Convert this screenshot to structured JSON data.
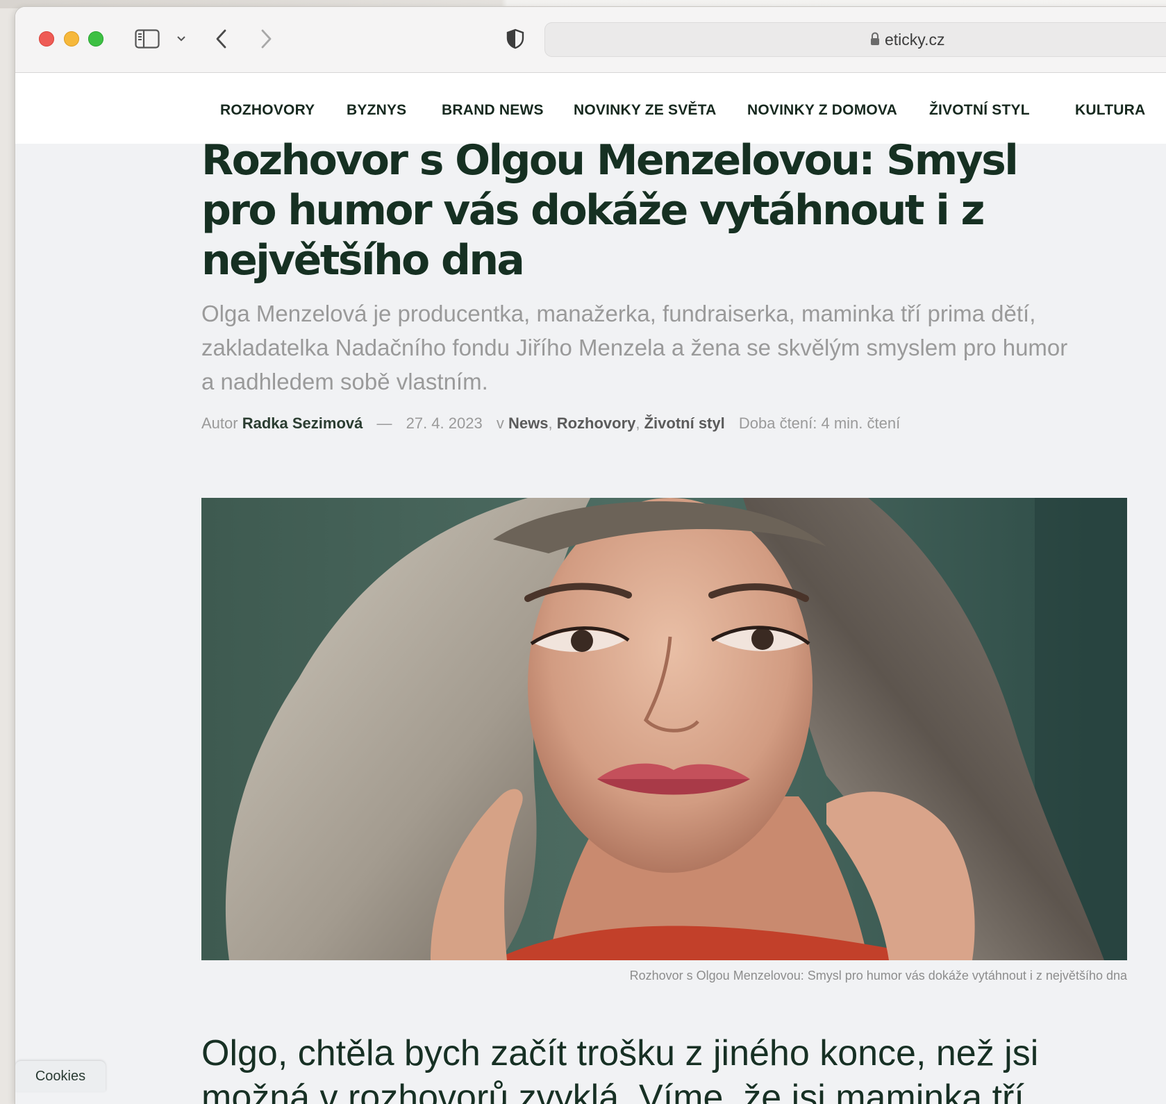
{
  "browser": {
    "url": "eticky.cz"
  },
  "nav": {
    "items": [
      "ROZHOVORY",
      "BYZNYS",
      "BRAND NEWS",
      "NOVINKY ZE SVĚTA",
      "NOVINKY Z DOMOVA",
      "ŽIVOTNÍ STYL",
      "KULTURA"
    ]
  },
  "article": {
    "title": "Rozhovor s Olgou Menzelovou: Smysl pro humor vás dokáže vytáhnout i z největšího dna",
    "perex": "Olga Menzelová je producentka, manažerka, fundraiserka, maminka tří prima dětí, zakladatelka Nadačního fondu Jiřího Menzela a žena se skvělým smyslem pro humor a nadhledem sobě vlastním.",
    "meta": {
      "author_label": "Autor",
      "author": "Radka Sezimová",
      "separator": "—",
      "date": "27. 4. 2023",
      "in_label": "v",
      "categories": [
        "News",
        "Rozhovory",
        "Životní styl"
      ],
      "reading_time": "Doba čtení: 4 min. čtení"
    },
    "image_caption": "Rozhovor s Olgou Menzelovou: Smysl pro humor vás dokáže vytáhnout i z největšího dna",
    "first_question": "Olgo, chtěla bych začít trošku z jiného konce, než jsi možná v rozhovorů zvyklá. Víme, že jsi maminka tří"
  },
  "cookies": {
    "label": "Cookies"
  },
  "icons": {
    "traffic_lights": [
      "close",
      "minimize",
      "zoom"
    ],
    "toolbar": [
      "sidebar-icon",
      "chevron-down-icon",
      "back-arrow-icon",
      "forward-arrow-icon",
      "privacy-shield-icon",
      "lock-icon"
    ]
  }
}
